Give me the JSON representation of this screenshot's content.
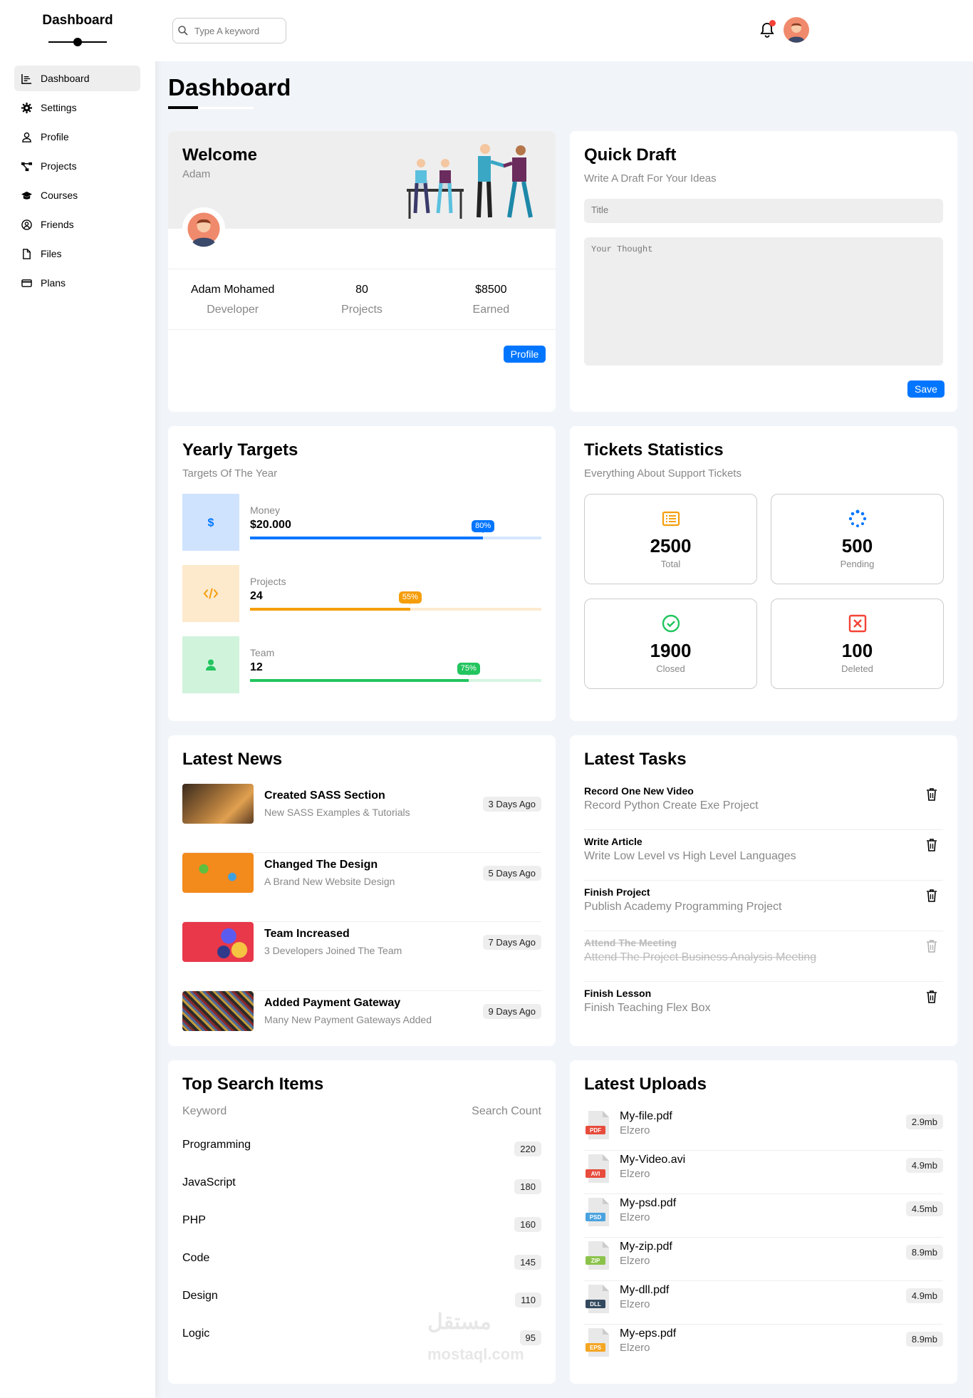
{
  "sidebar": {
    "brand": "Dashboard",
    "items": [
      {
        "label": "Dashboard",
        "icon": "chart-line-icon",
        "active": true
      },
      {
        "label": "Settings",
        "icon": "gear-icon"
      },
      {
        "label": "Profile",
        "icon": "user-icon"
      },
      {
        "label": "Projects",
        "icon": "diagram-project-icon"
      },
      {
        "label": "Courses",
        "icon": "graduation-cap-icon"
      },
      {
        "label": "Friends",
        "icon": "circle-user-icon"
      },
      {
        "label": "Files",
        "icon": "file-icon"
      },
      {
        "label": "Plans",
        "icon": "credit-card-icon"
      }
    ]
  },
  "header": {
    "search_placeholder": "Type A keyword"
  },
  "page_title": "Dashboard",
  "welcome": {
    "title": "Welcome",
    "name": "Adam",
    "stats": [
      {
        "value": "Adam Mohamed",
        "label": "Developer"
      },
      {
        "value": "80",
        "label": "Projects"
      },
      {
        "value": "$8500",
        "label": "Earned"
      }
    ],
    "button": "Profile"
  },
  "draft": {
    "title": "Quick Draft",
    "subtitle": "Write A Draft For Your Ideas",
    "title_placeholder": "Title",
    "thought_placeholder": "Your Thought",
    "button": "Save"
  },
  "targets": {
    "title": "Yearly Targets",
    "subtitle": "Targets Of The Year",
    "items": [
      {
        "label": "Money",
        "value": "$20.000",
        "percent": 80,
        "percent_label": "80%",
        "color": "#0075ff",
        "bg": "#cfe3ff",
        "track": "#d5e6ff"
      },
      {
        "label": "Projects",
        "value": "24",
        "percent": 55,
        "percent_label": "55%",
        "color": "#f59e0b",
        "bg": "#fde9cc",
        "track": "#fdebd0"
      },
      {
        "label": "Team",
        "value": "12",
        "percent": 75,
        "percent_label": "75%",
        "color": "#22c55e",
        "bg": "#d0f3dc",
        "track": "#d6f5e1"
      }
    ]
  },
  "tickets": {
    "title": "Tickets Statistics",
    "subtitle": "Everything About Support Tickets",
    "items": [
      {
        "value": "2500",
        "label": "Total",
        "color": "#f59e0b"
      },
      {
        "value": "500",
        "label": "Pending",
        "color": "#0075ff"
      },
      {
        "value": "1900",
        "label": "Closed",
        "color": "#22c55e"
      },
      {
        "value": "100",
        "label": "Deleted",
        "color": "#f44336"
      }
    ]
  },
  "news": {
    "title": "Latest News",
    "items": [
      {
        "title": "Created SASS Section",
        "desc": "New SASS Examples & Tutorials",
        "age": "3 Days Ago"
      },
      {
        "title": "Changed The Design",
        "desc": "A Brand New Website Design",
        "age": "5 Days Ago"
      },
      {
        "title": "Team Increased",
        "desc": "3 Developers Joined The Team",
        "age": "7 Days Ago"
      },
      {
        "title": "Added Payment Gateway",
        "desc": "Many New Payment Gateways Added",
        "age": "9 Days Ago"
      }
    ]
  },
  "tasks": {
    "title": "Latest Tasks",
    "items": [
      {
        "title": "Record One New Video",
        "desc": "Record Python Create Exe Project",
        "done": false
      },
      {
        "title": "Write Article",
        "desc": "Write Low Level vs High Level Languages",
        "done": false
      },
      {
        "title": "Finish Project",
        "desc": "Publish Academy Programming Project",
        "done": false
      },
      {
        "title": "Attend The Meeting",
        "desc": "Attend The Project Business Analysis Meeting",
        "done": true
      },
      {
        "title": "Finish Lesson",
        "desc": "Finish Teaching Flex Box",
        "done": false
      }
    ]
  },
  "search": {
    "title": "Top Search Items",
    "col_keyword": "Keyword",
    "col_count": "Search Count",
    "items": [
      {
        "keyword": "Programming",
        "count": "220"
      },
      {
        "keyword": "JavaScript",
        "count": "180"
      },
      {
        "keyword": "PHP",
        "count": "160"
      },
      {
        "keyword": "Code",
        "count": "145"
      },
      {
        "keyword": "Design",
        "count": "110"
      },
      {
        "keyword": "Logic",
        "count": "95"
      }
    ]
  },
  "uploads": {
    "title": "Latest Uploads",
    "items": [
      {
        "name": "My-file.pdf",
        "author": "Elzero",
        "size": "2.9mb",
        "type": "PDF",
        "color": "#e74c3c"
      },
      {
        "name": "My-Video.avi",
        "author": "Elzero",
        "size": "4.9mb",
        "type": "AVI",
        "color": "#e74c3c"
      },
      {
        "name": "My-psd.pdf",
        "author": "Elzero",
        "size": "4.5mb",
        "type": "PSD",
        "color": "#4aa3df"
      },
      {
        "name": "My-zip.pdf",
        "author": "Elzero",
        "size": "8.9mb",
        "type": "ZIP",
        "color": "#8bc34a"
      },
      {
        "name": "My-dll.pdf",
        "author": "Elzero",
        "size": "4.9mb",
        "type": "DLL",
        "color": "#34495e"
      },
      {
        "name": "My-eps.pdf",
        "author": "Elzero",
        "size": "8.9mb",
        "type": "EPS",
        "color": "#f5a623"
      }
    ]
  },
  "watermark": {
    "arabic": "مستقل",
    "latin": "mostaql.com"
  }
}
